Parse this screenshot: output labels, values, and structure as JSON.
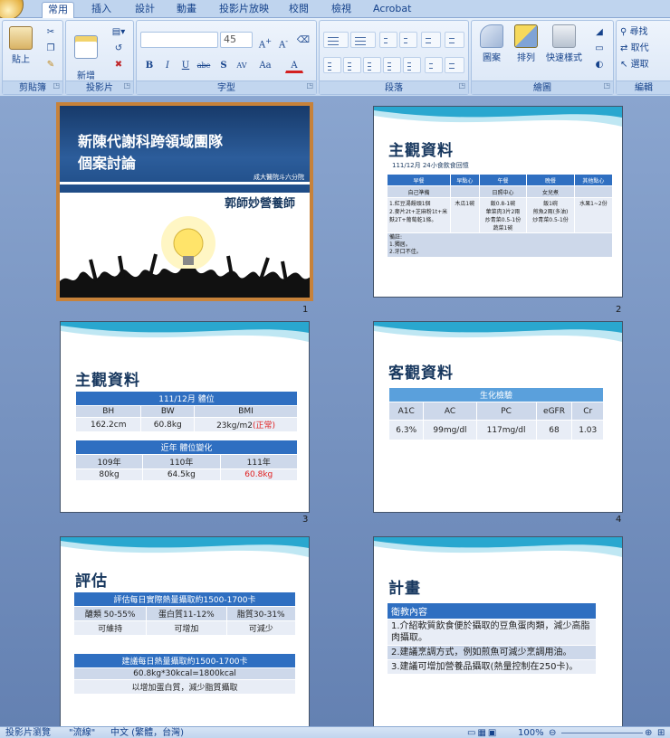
{
  "tabs": [
    "常用",
    "插入",
    "設計",
    "動畫",
    "投影片放映",
    "校閱",
    "檢視",
    "Acrobat"
  ],
  "ribbon": {
    "clipboard": {
      "label": "剪貼簿",
      "paste": "貼上"
    },
    "slides": {
      "label": "投影片",
      "new_slide": "新增\n投影片"
    },
    "font": {
      "label": "字型",
      "size": "45"
    },
    "paragraph": {
      "label": "段落"
    },
    "drawing": {
      "label": "繪圖",
      "shapes": "圖案",
      "arrange": "排列",
      "quick_styles": "快速樣式"
    },
    "editing": {
      "label": "編輯",
      "find": "尋找",
      "replace": "取代",
      "select": "選取"
    }
  },
  "slides": {
    "s1": {
      "num": "1",
      "title_line1": "新陳代謝科跨領域團隊",
      "title_line2": "個案討論",
      "org": "成大醫院斗六分院",
      "presenter": "郭師妙營養師"
    },
    "s2": {
      "num": "2",
      "title": "主觀資料",
      "subtitle": "111/12月 24小食飲食回憶",
      "headers": [
        "早餐",
        "早點心",
        "午餐",
        "晚餐",
        "其他點心"
      ],
      "sources": [
        "自己準備",
        "",
        "日照中心",
        "女兒煮",
        ""
      ],
      "meals": [
        "1.紅豆湯饅頭1個\n2.麥片2t+芝麻粉1t+米麩2T+葡萄乾1條。",
        "木瓜1碗",
        "飯0.8-1碗\n葷菜肉3片2兩\n炒青菜0.5-1份\n蔬菜1碗",
        "飯1碗\n煎魚2兩(多油)\n炒青菜0.5-1份",
        "水果1~2份"
      ],
      "note_title": "備註:",
      "notes": [
        "1.獨居。",
        "2.牙口不佳。"
      ]
    },
    "s3": {
      "num": "3",
      "title": "主觀資料",
      "table1_title": "111/12月 體位",
      "table1_headers": [
        "BH",
        "BW",
        "BMI"
      ],
      "table1_values": [
        "162.2cm",
        "60.8kg",
        "23kg/m2"
      ],
      "bmi_note": "(正常)",
      "table2_title": "近年 體位變化",
      "table2_headers": [
        "109年",
        "110年",
        "111年"
      ],
      "table2_values": [
        "80kg",
        "64.5kg",
        "60.8kg"
      ]
    },
    "s4": {
      "num": "4",
      "title": "客觀資料",
      "table_title": "生化檢驗",
      "headers": [
        "A1C",
        "AC",
        "PC",
        "eGFR",
        "Cr"
      ],
      "values": [
        "6.3%",
        "99mg/dl",
        "117mg/dl",
        "68",
        "1.03"
      ]
    },
    "s5": {
      "num": "5",
      "title": "評估",
      "t1_title": "評估每日實際熱量攝取約1500-1700卡",
      "t1_headers": [
        "醣類 50-55%",
        "蛋白質11-12%",
        "脂質30-31%"
      ],
      "t1_values": [
        "可維持",
        "可增加",
        "可減少"
      ],
      "t2_title": "建議每日熱量攝取約1500-1700卡",
      "t2_line1": "60.8kg*30kcal=1800kcal",
      "t2_line2": "以增加蛋白質，減少脂質攝取"
    },
    "s6": {
      "num": "6",
      "title": "計畫",
      "table_title": "衛教內容",
      "items": [
        "1.介紹軟質飲食便於攝取的豆魚蛋肉類，減少高脂肉攝取。",
        "2.建議烹調方式，例如煎魚可減少烹調用油。",
        "3.建議可增加營養品攝取(熱量控制在250卡)。"
      ]
    }
  },
  "status": {
    "view": "投影片瀏覽",
    "theme": "\"流線\"",
    "language": "中文 (繁體，台灣)",
    "zoom": "100%"
  },
  "colors": {
    "accent": "#2f6fc1",
    "selection": "#c7823a",
    "title": "#17375e",
    "warn": "#e02020"
  }
}
